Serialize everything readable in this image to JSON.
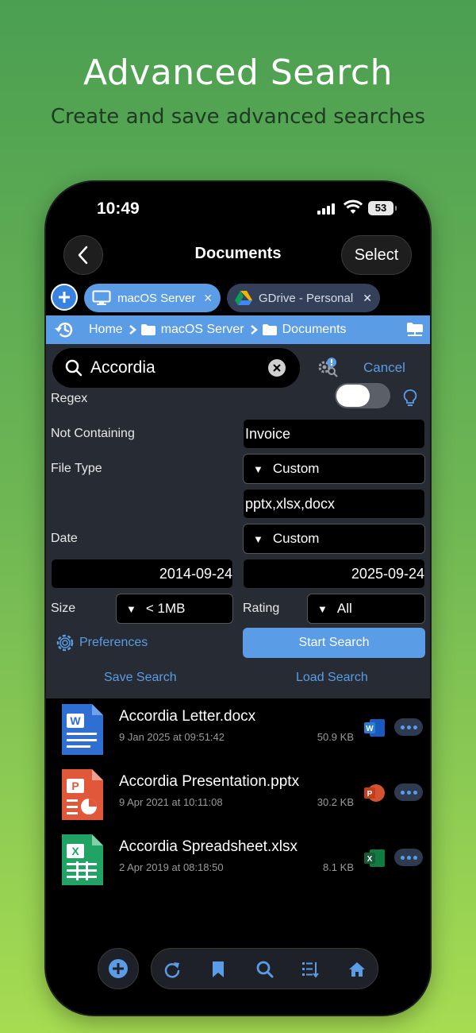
{
  "promo": {
    "title": "Advanced Search",
    "subtitle": "Create and save advanced searches"
  },
  "status_bar": {
    "time": "10:49",
    "battery": "53"
  },
  "nav": {
    "title": "Documents",
    "select_label": "Select"
  },
  "tabs": [
    {
      "label": "macOS Server",
      "icon": "monitor-icon",
      "active": true
    },
    {
      "label": "GDrive - Personal",
      "icon": "google-drive-icon",
      "active": false
    }
  ],
  "breadcrumb": [
    "Home",
    "macOS Server",
    "Documents"
  ],
  "search": {
    "query": "Accordia",
    "cancel_label": "Cancel",
    "regex_label": "Regex",
    "regex_enabled": false,
    "not_containing_label": "Not Containing",
    "not_containing_value": "Invoice",
    "file_type_label": "File Type",
    "file_type_value": "Custom",
    "file_type_extensions": "pptx,xlsx,docx",
    "date_label": "Date",
    "date_value": "Custom",
    "date_from": "2014-09-24",
    "date_to": "2025-09-24",
    "size_label": "Size",
    "size_value": "< 1MB",
    "rating_label": "Rating",
    "rating_value": "All",
    "preferences_label": "Preferences",
    "start_label": "Start Search",
    "save_label": "Save Search",
    "load_label": "Load Search"
  },
  "files": [
    {
      "name": "Accordia Letter.docx",
      "date": "9 Jan 2025 at 09:51:42",
      "size": "50.9 KB",
      "type": "word"
    },
    {
      "name": "Accordia Presentation.pptx",
      "date": "9 Apr 2021 at 10:11:08",
      "size": "30.2 KB",
      "type": "powerpoint"
    },
    {
      "name": "Accordia Spreadsheet.xlsx",
      "date": "2 Apr 2019 at 08:18:50",
      "size": "8.1 KB",
      "type": "excel"
    }
  ],
  "colors": {
    "accent": "#5b9ce6",
    "word": "#2f6fd1",
    "powerpoint": "#e0573a",
    "excel": "#21a366",
    "background_top": "#4b9f52",
    "background_bottom": "#a6dc52"
  },
  "toolbar": {
    "icons": [
      "plus-icon",
      "refresh-icon",
      "bookmark-icon",
      "search-icon",
      "sort-icon",
      "home-icon"
    ]
  }
}
